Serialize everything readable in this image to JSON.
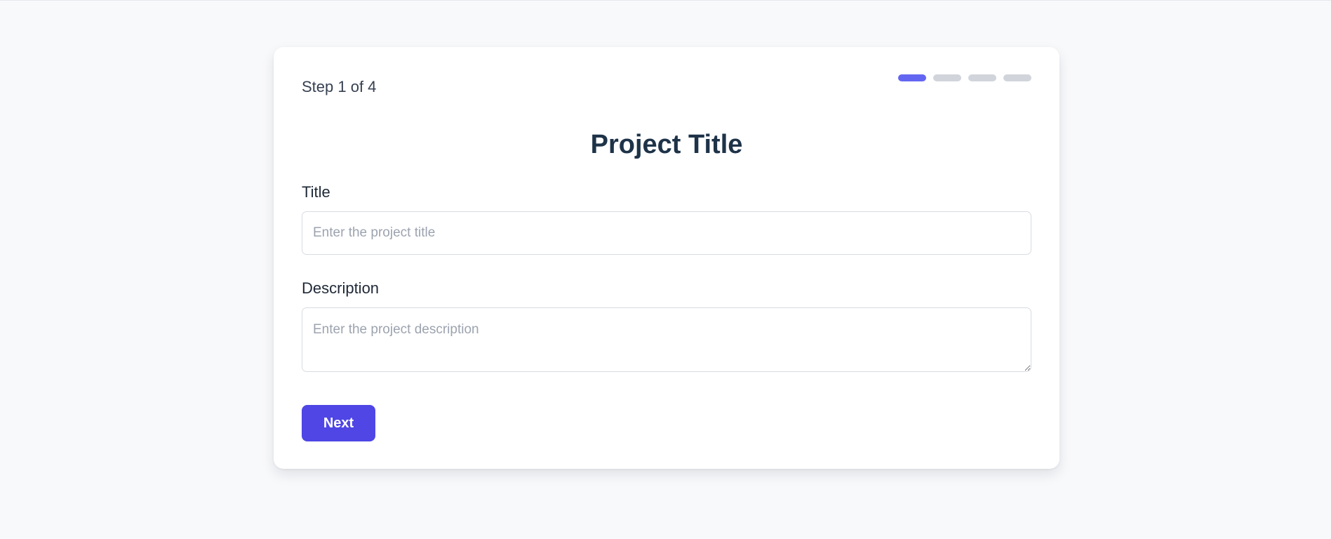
{
  "wizard": {
    "step_label": "Step 1 of 4",
    "total_steps": 4,
    "current_step": 1,
    "accent_color": "#6366f1",
    "inactive_color": "#d1d5db"
  },
  "form": {
    "heading": "Project Title",
    "title_label": "Title",
    "title_placeholder": "Enter the project title",
    "title_value": "",
    "description_label": "Description",
    "description_placeholder": "Enter the project description",
    "description_value": "",
    "next_label": "Next",
    "button_color": "#4f46e5"
  }
}
